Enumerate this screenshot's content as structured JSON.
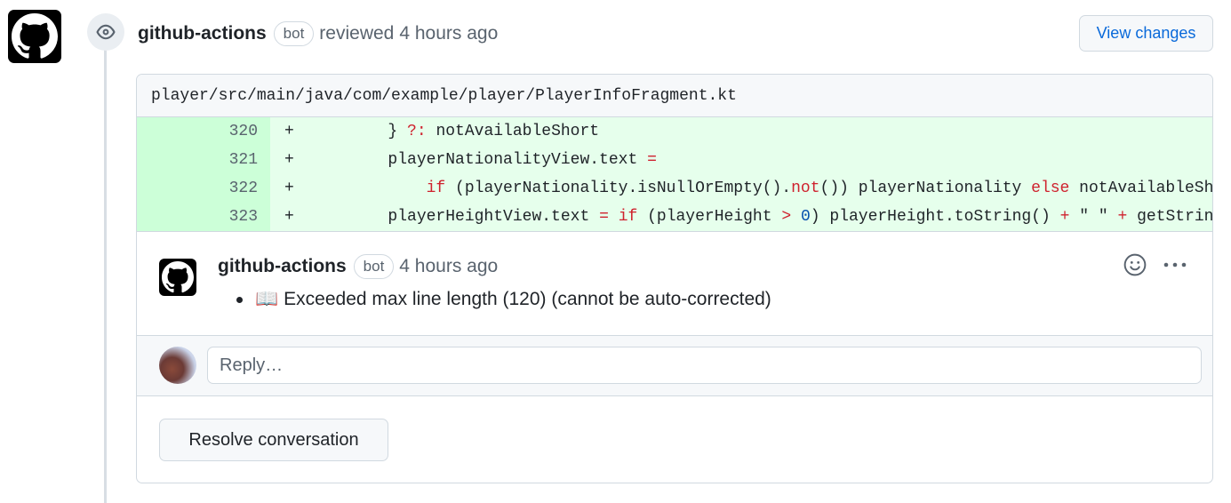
{
  "review": {
    "author": "github-actions",
    "bot_label": "bot",
    "action": "reviewed",
    "time": "4 hours ago",
    "view_changes_label": "View changes"
  },
  "file": {
    "path": "player/src/main/java/com/example/player/PlayerInfoFragment.kt"
  },
  "diff_lines": [
    {
      "num": "320",
      "sign": "+"
    },
    {
      "num": "321",
      "sign": "+"
    },
    {
      "num": "322",
      "sign": "+"
    },
    {
      "num": "323",
      "sign": "+"
    }
  ],
  "code": {
    "l320": [
      "        } ",
      "?:",
      " notAvailableShort"
    ],
    "l321": [
      "        playerNationalityView.text ",
      "="
    ],
    "l322": [
      "            ",
      "if",
      " (playerNationality.isNullOrEmpty().",
      "not",
      "()) playerNationality ",
      "else",
      " notAvailableShort"
    ],
    "l323": [
      "        playerHeightView.text ",
      "=",
      " ",
      "if",
      " (playerHeight ",
      ">",
      " ",
      "0",
      ") playerHeight.toString() ",
      "+",
      " \" \" ",
      "+",
      " getString(R.string.height_unit)"
    ]
  },
  "comment": {
    "author": "github-actions",
    "bot_label": "bot",
    "time": "4 hours ago",
    "emoji": "📖",
    "text": "Exceeded max line length (120) (cannot be auto-corrected)"
  },
  "reply": {
    "placeholder": "Reply…"
  },
  "resolve_label": "Resolve conversation",
  "icons": [
    "github-logo-icon",
    "eye-icon",
    "smiley-icon",
    "kebab-menu-icon"
  ],
  "colors": {
    "added_bg": "#e6ffec",
    "added_num_bg": "#ccffd8",
    "keyword": "#cf222e",
    "number": "#0550ae",
    "link": "#0969da"
  }
}
